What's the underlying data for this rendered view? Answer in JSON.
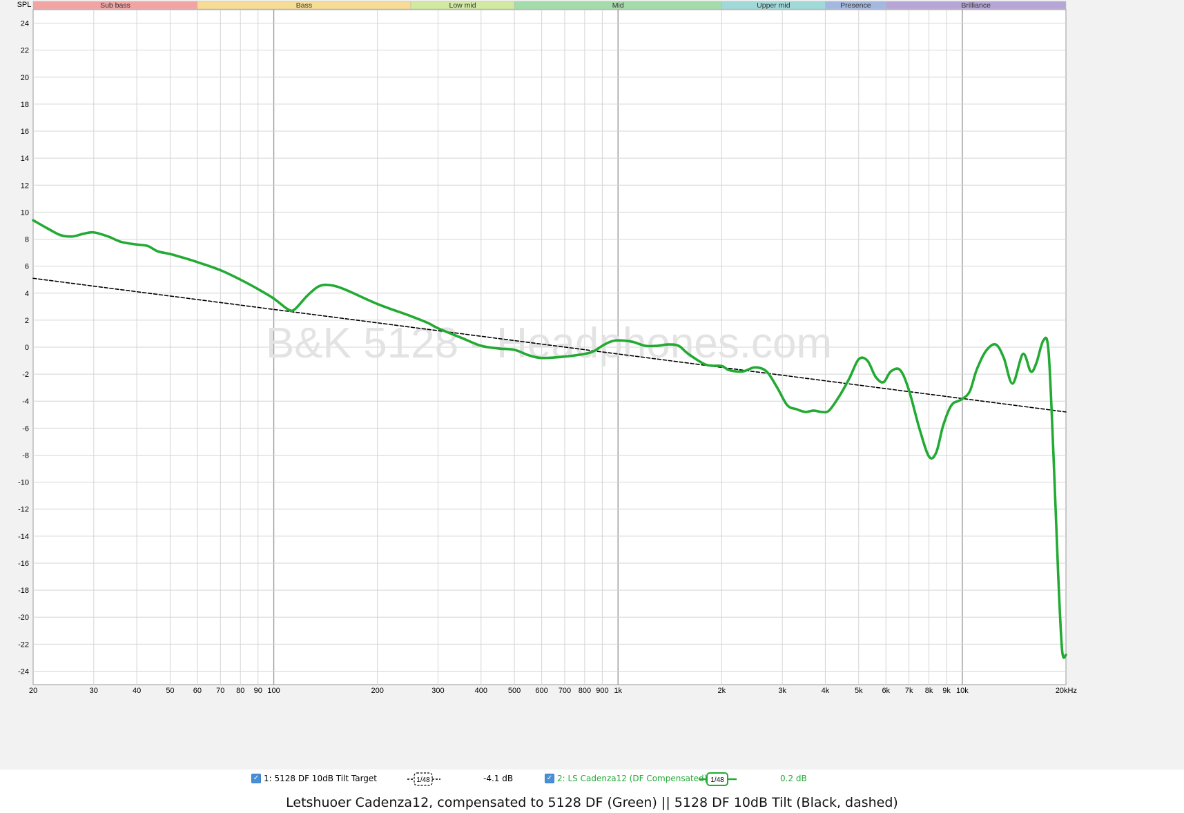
{
  "chart_data": {
    "type": "line",
    "title": "Letshuoer Cadenza12, compensated to 5128 DF (Green) || 5128 DF 10dB Tilt (Black, dashed)",
    "ylabel": "SPL",
    "x_scale": "log",
    "xlim": [
      20,
      20000
    ],
    "ylim": [
      -25,
      25
    ],
    "grid": true,
    "watermark": "B&K 5128 - Headphones.com",
    "x_ticks": [
      {
        "v": 20,
        "label": "20"
      },
      {
        "v": 30,
        "label": "30"
      },
      {
        "v": 40,
        "label": "40"
      },
      {
        "v": 50,
        "label": "50"
      },
      {
        "v": 60,
        "label": "60"
      },
      {
        "v": 70,
        "label": "70"
      },
      {
        "v": 80,
        "label": "80"
      },
      {
        "v": 90,
        "label": "90"
      },
      {
        "v": 100,
        "label": "100"
      },
      {
        "v": 200,
        "label": "200"
      },
      {
        "v": 300,
        "label": "300"
      },
      {
        "v": 400,
        "label": "400"
      },
      {
        "v": 500,
        "label": "500"
      },
      {
        "v": 600,
        "label": "600"
      },
      {
        "v": 700,
        "label": "700"
      },
      {
        "v": 800,
        "label": "800"
      },
      {
        "v": 900,
        "label": "900"
      },
      {
        "v": 1000,
        "label": "1k"
      },
      {
        "v": 2000,
        "label": "2k"
      },
      {
        "v": 3000,
        "label": "3k"
      },
      {
        "v": 4000,
        "label": "4k"
      },
      {
        "v": 5000,
        "label": "5k"
      },
      {
        "v": 6000,
        "label": "6k"
      },
      {
        "v": 7000,
        "label": "7k"
      },
      {
        "v": 8000,
        "label": "8k"
      },
      {
        "v": 9000,
        "label": "9k"
      },
      {
        "v": 10000,
        "label": "10k"
      },
      {
        "v": 20000,
        "label": "20kHz"
      }
    ],
    "y_ticks": [
      24,
      22,
      20,
      18,
      16,
      14,
      12,
      10,
      8,
      6,
      4,
      2,
      0,
      -2,
      -4,
      -6,
      -8,
      -10,
      -12,
      -14,
      -16,
      -18,
      -20,
      -22,
      -24
    ],
    "bands": [
      {
        "name": "Sub bass",
        "from": 20,
        "to": 60,
        "color": "#f4a3a3"
      },
      {
        "name": "Bass",
        "from": 60,
        "to": 250,
        "color": "#f7dc94"
      },
      {
        "name": "Low mid",
        "from": 250,
        "to": 500,
        "color": "#d2e9a0"
      },
      {
        "name": "Mid",
        "from": 500,
        "to": 2000,
        "color": "#a2dca8"
      },
      {
        "name": "Upper mid",
        "from": 2000,
        "to": 4000,
        "color": "#9fd9d9"
      },
      {
        "name": "Presence",
        "from": 4000,
        "to": 6000,
        "color": "#a3b8e0"
      },
      {
        "name": "Brilliance",
        "from": 6000,
        "to": 20000,
        "color": "#b6a6d6"
      }
    ],
    "series": [
      {
        "name": "1: 5128 DF 10dB Tilt Target",
        "color": "#000000",
        "style": "dashed",
        "smoothing": "1/48",
        "level": "-4.1 dB",
        "points": [
          [
            20,
            5.1
          ],
          [
            20000,
            -4.8
          ]
        ]
      },
      {
        "name": "2: LS Cadenza12 (DF Compensated)",
        "color": "#22aa33",
        "style": "solid",
        "smoothing": "1/48",
        "level": "0.2 dB",
        "points": [
          [
            20,
            9.4
          ],
          [
            22,
            8.8
          ],
          [
            24,
            8.3
          ],
          [
            26,
            8.2
          ],
          [
            28,
            8.4
          ],
          [
            30,
            8.5
          ],
          [
            33,
            8.2
          ],
          [
            36,
            7.8
          ],
          [
            40,
            7.6
          ],
          [
            43,
            7.5
          ],
          [
            46,
            7.1
          ],
          [
            50,
            6.9
          ],
          [
            55,
            6.6
          ],
          [
            60,
            6.3
          ],
          [
            70,
            5.7
          ],
          [
            80,
            5.0
          ],
          [
            90,
            4.3
          ],
          [
            100,
            3.6
          ],
          [
            110,
            2.8
          ],
          [
            115,
            2.8
          ],
          [
            125,
            3.8
          ],
          [
            135,
            4.5
          ],
          [
            145,
            4.6
          ],
          [
            160,
            4.3
          ],
          [
            200,
            3.2
          ],
          [
            250,
            2.3
          ],
          [
            280,
            1.8
          ],
          [
            300,
            1.4
          ],
          [
            350,
            0.7
          ],
          [
            400,
            0.1
          ],
          [
            450,
            -0.1
          ],
          [
            500,
            -0.2
          ],
          [
            550,
            -0.6
          ],
          [
            600,
            -0.8
          ],
          [
            700,
            -0.7
          ],
          [
            800,
            -0.5
          ],
          [
            850,
            -0.3
          ],
          [
            900,
            0.1
          ],
          [
            950,
            0.4
          ],
          [
            1000,
            0.5
          ],
          [
            1100,
            0.4
          ],
          [
            1200,
            0.1
          ],
          [
            1300,
            0.1
          ],
          [
            1400,
            0.2
          ],
          [
            1500,
            0.1
          ],
          [
            1600,
            -0.5
          ],
          [
            1800,
            -1.3
          ],
          [
            2000,
            -1.4
          ],
          [
            2100,
            -1.7
          ],
          [
            2300,
            -1.8
          ],
          [
            2500,
            -1.5
          ],
          [
            2700,
            -1.8
          ],
          [
            2900,
            -3.0
          ],
          [
            3100,
            -4.3
          ],
          [
            3300,
            -4.6
          ],
          [
            3500,
            -4.8
          ],
          [
            3700,
            -4.7
          ],
          [
            3900,
            -4.8
          ],
          [
            4100,
            -4.7
          ],
          [
            4400,
            -3.6
          ],
          [
            4700,
            -2.3
          ],
          [
            5000,
            -0.9
          ],
          [
            5300,
            -1.0
          ],
          [
            5600,
            -2.2
          ],
          [
            5900,
            -2.6
          ],
          [
            6200,
            -1.8
          ],
          [
            6600,
            -1.7
          ],
          [
            7000,
            -3.2
          ],
          [
            7500,
            -6.0
          ],
          [
            8000,
            -8.1
          ],
          [
            8400,
            -7.8
          ],
          [
            8800,
            -5.8
          ],
          [
            9300,
            -4.3
          ],
          [
            9900,
            -3.9
          ],
          [
            10500,
            -3.3
          ],
          [
            11000,
            -1.7
          ],
          [
            11700,
            -0.3
          ],
          [
            12500,
            0.2
          ],
          [
            13200,
            -0.8
          ],
          [
            14000,
            -2.7
          ],
          [
            15000,
            -0.5
          ],
          [
            15800,
            -1.8
          ],
          [
            16400,
            -1.2
          ],
          [
            17200,
            0.5
          ],
          [
            17800,
            -0.3
          ],
          [
            18400,
            -8.0
          ],
          [
            19000,
            -17.0
          ],
          [
            19500,
            -22.5
          ],
          [
            20000,
            -22.8
          ]
        ]
      }
    ]
  }
}
